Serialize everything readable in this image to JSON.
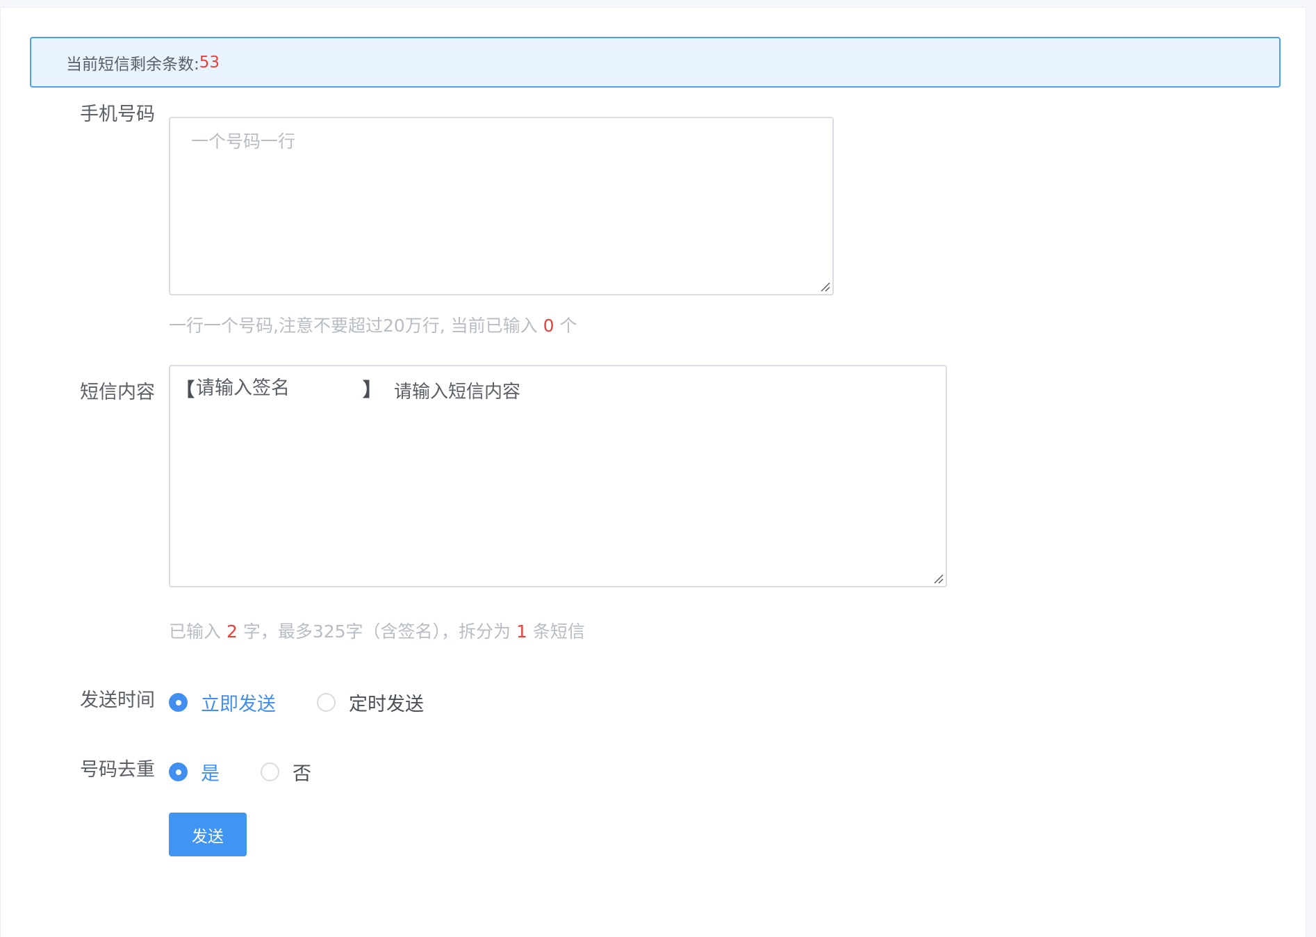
{
  "alert": {
    "prefix": "当前短信剩余条数:",
    "count": "53"
  },
  "phone": {
    "label": "手机号码",
    "placeholder": "一个号码一行",
    "value": "",
    "hint_prefix": "一行一个号码,注意不要超过20万行, 当前已输入",
    "hint_count": "0",
    "hint_suffix": "个"
  },
  "content": {
    "label": "短信内容",
    "sig_open": "【",
    "sig_close": "】",
    "signature_placeholder": "请输入签名",
    "content_placeholder": "请输入短信内容",
    "hint_prefix": "已输入",
    "hint_chars": "2",
    "hint_middle": "字，最多325字（含签名），拆分为",
    "hint_parts": "1",
    "hint_suffix": "条短信"
  },
  "send_time": {
    "label": "发送时间",
    "options": [
      "立即发送",
      "定时发送"
    ],
    "selected": "立即发送"
  },
  "dedupe": {
    "label": "号码去重",
    "options": [
      "是",
      "否"
    ],
    "selected": "是"
  },
  "send_button": {
    "label": "发送"
  },
  "colors": {
    "primary": "#4094f2",
    "alert_bg": "#e8f3fe",
    "alert_border": "#4c9ef0",
    "highlight_red": "#e8413b"
  }
}
